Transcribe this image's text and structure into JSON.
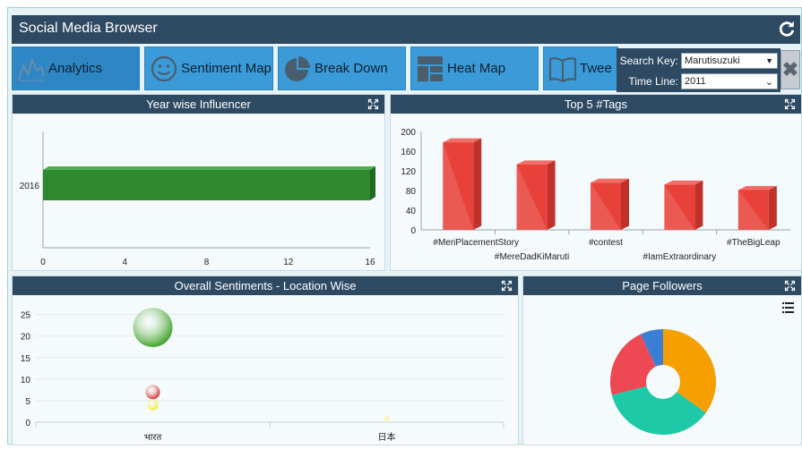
{
  "header": {
    "title": "Social Media Browser",
    "refresh_icon": "refresh-icon"
  },
  "nav": {
    "tabs": [
      {
        "label": "Analytics",
        "icon": "analytics-icon",
        "active": true
      },
      {
        "label": "Sentiment Map",
        "icon": "smiley-icon",
        "active": false
      },
      {
        "label": "Break Down",
        "icon": "pie-icon",
        "active": false
      },
      {
        "label": "Heat Map",
        "icon": "heatmap-icon",
        "active": false
      },
      {
        "label": "Twee",
        "icon": "book-icon",
        "active": false
      }
    ]
  },
  "search": {
    "key_label": "Search Key:",
    "key_value": "Marutisuzuki",
    "timeline_label": "Time Line:",
    "timeline_value": "2011",
    "close_icon": "close-icon"
  },
  "panels": {
    "influencer": {
      "title": "Year wise Influencer"
    },
    "tags": {
      "title": "Top 5 #Tags"
    },
    "sentiments": {
      "title": "Overall Sentiments - Location Wise"
    },
    "followers": {
      "title": "Page Followers",
      "menu_icon": "list-icon"
    }
  },
  "colors": {
    "header": "#2e4a63",
    "tab": "#3b9bd9",
    "bar_green": "#2f8a2f",
    "bar_red": "#e8413a"
  },
  "chart_data": [
    {
      "type": "bar",
      "orientation": "horizontal",
      "categories": [
        "2016"
      ],
      "values": [
        16
      ],
      "xticks": [
        "0",
        "4",
        "8",
        "12",
        "16"
      ],
      "xlim": [
        0,
        16
      ],
      "title": ""
    },
    {
      "type": "bar",
      "categories": [
        "#MeriPlacementStory",
        "#MereDadKiMaruti",
        "#contest",
        "#IamExtraordinary",
        "#TheBigLeap"
      ],
      "values": [
        178,
        133,
        96,
        92,
        81
      ],
      "yticks": [
        "0",
        "40",
        "80",
        "120",
        "160",
        "200"
      ],
      "ylim": [
        0,
        200
      ]
    },
    {
      "type": "scatter",
      "categories": [
        "भारत",
        "日本"
      ],
      "yticks": [
        "0",
        "5",
        "10",
        "15",
        "20",
        "25"
      ],
      "ylim": [
        0,
        27
      ],
      "series": [
        {
          "color": "#2e9a14",
          "points": [
            {
              "x": "भारत",
              "y": 22,
              "size": 22
            }
          ]
        },
        {
          "color": "#d21c1c",
          "points": [
            {
              "x": "भारत",
              "y": 7,
              "size": 8
            }
          ]
        },
        {
          "color": "#f2e70f",
          "points": [
            {
              "x": "भारत",
              "y": 4,
              "size": 6
            },
            {
              "x": "日本",
              "y": 1,
              "size": 2.5
            }
          ]
        }
      ]
    },
    {
      "type": "pie",
      "donut": true,
      "slices": [
        {
          "value": 35,
          "color": "#f5a000"
        },
        {
          "value": 36,
          "color": "#1dc9a6"
        },
        {
          "value": 22,
          "color": "#ee4853"
        },
        {
          "value": 7,
          "color": "#3b7fd4"
        }
      ]
    }
  ]
}
